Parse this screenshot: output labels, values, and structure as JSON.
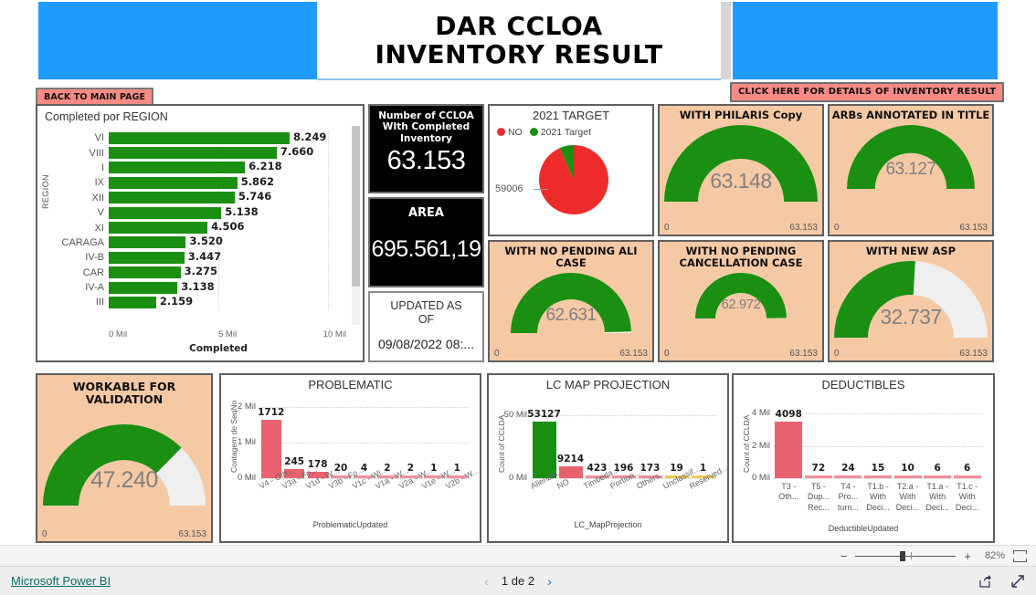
{
  "header": {
    "title_line1": "DAR CCLOA",
    "title_line2": "INVENTORY RESULT",
    "back_button": "BACK TO MAIN PAGE",
    "details_button": "CLICK HERE FOR DETAILS OF INVENTORY RESULT"
  },
  "colors": {
    "green": "#1a8f12",
    "red": "#ee2b2b",
    "pink_bar": "#e8636f",
    "pink_light": "#ef8f98",
    "yellow": "#f2c75c",
    "peach_tile": "#f6c9a5",
    "blue_banner": "#1f9bff",
    "button_pink": "#f98a84",
    "gauge_empty": "#efefef",
    "value_gray": "#808080"
  },
  "kpi": {
    "count_label": "Number of CCLOA With Completed Inventory",
    "count_label_lines": [
      "Number of CCLOA",
      "WIth Completed",
      "Inventory"
    ],
    "count_value": "63.153",
    "area_label": "AREA",
    "area_value": "695.561,19",
    "updated_label_lines": [
      "UPDATED AS",
      "OF"
    ],
    "updated_value": "09/08/2022 08:..."
  },
  "gauges": [
    {
      "id": "philaris",
      "title": "WITH PHILARIS Copy",
      "value": "63.148",
      "value_num": 63148,
      "min": "0",
      "max": "63.153",
      "max_num": 63153
    },
    {
      "id": "arbs",
      "title": "ARBs ANNOTATED IN TITLE",
      "value": "63.127",
      "value_num": 63127,
      "min": "0",
      "max": "63.153",
      "max_num": 63153
    },
    {
      "id": "ali",
      "title": "WITH NO PENDING ALI CASE",
      "value": "62.631",
      "value_num": 62631,
      "min": "0",
      "max": "63.153",
      "max_num": 63153
    },
    {
      "id": "cancel",
      "title": "WITH NO PENDING CANCELLATION CASE",
      "value": "62.972",
      "value_num": 62972,
      "min": "0",
      "max": "63.153",
      "max_num": 63153
    },
    {
      "id": "asp",
      "title": "WITH NEW ASP",
      "value": "32.737",
      "value_num": 32737,
      "min": "0",
      "max": "63.153",
      "max_num": 63153
    },
    {
      "id": "workable",
      "title": "WORKABLE FOR VALIDATION",
      "value": "47.240",
      "value_num": 47240,
      "min": "0",
      "max": "63.153",
      "max_num": 63153
    }
  ],
  "chart_data": [
    {
      "id": "region",
      "type": "bar",
      "title": "Completed por REGION",
      "xlabel": "Completed",
      "ylabel": "REGION",
      "categories": [
        "VI",
        "VIII",
        "I",
        "IX",
        "XII",
        "V",
        "XI",
        "CARAGA",
        "IV-B",
        "CAR",
        "IV-A",
        "III"
      ],
      "values": [
        8249,
        7660,
        6218,
        5862,
        5746,
        5138,
        4506,
        3520,
        3447,
        3275,
        3138,
        2159
      ],
      "value_labels": [
        "8.249",
        "7.660",
        "6.218",
        "5.862",
        "5.746",
        "5.138",
        "4.506",
        "3.520",
        "3.447",
        "3.275",
        "3.138",
        "2.159"
      ],
      "xticks": [
        "0 Mil",
        "5 Mil",
        "10 Mil"
      ],
      "xlim": [
        0,
        10000
      ],
      "orientation": "horizontal",
      "grid": true,
      "series_color": "#1a8f12"
    },
    {
      "id": "target2021",
      "type": "pie",
      "title": "2021 TARGET",
      "legend": [
        "NO",
        "2021 Target"
      ],
      "legend_position": "top-left",
      "labels": [
        "NO",
        "2021 Target"
      ],
      "values": [
        59006,
        4147
      ],
      "annotations": [
        "59006"
      ],
      "colors": [
        "#ee2b2b",
        "#1a8f12"
      ]
    },
    {
      "id": "problematic",
      "type": "bar",
      "title": "PROBLEMATIC",
      "xlabel": "ProblematicUpdated",
      "ylabel": "Contagem de SeqNo",
      "categories": [
        "V4 - Oth...",
        "V3a - Fo...",
        "V1d - W...",
        "V3b - Fo...",
        "V1c - Wi...",
        "V1a - W...",
        "V2a - W...",
        "V1e - W...",
        "V2b - W..."
      ],
      "values": [
        1712,
        245,
        178,
        20,
        4,
        2,
        2,
        1,
        1
      ],
      "value_labels": [
        "1712",
        "245",
        "178",
        "20",
        "4",
        "2",
        "2",
        "1",
        "1"
      ],
      "yticks": [
        "0 Mil",
        "1 Mil",
        "2 Mil"
      ],
      "ylim": [
        0,
        2000
      ],
      "grid": true,
      "series_color": "#e8636f"
    },
    {
      "id": "lcmap",
      "type": "bar",
      "title": "LC MAP PROJECTION",
      "xlabel": "LC_MapProjection",
      "ylabel": "Count of CCLDA",
      "categories": [
        "Alienabl...",
        "NO",
        "Timberla...",
        "Portion ...",
        "Others",
        "Unclassif...",
        "Reserved..."
      ],
      "values": [
        53127,
        9214,
        423,
        196,
        173,
        19,
        1
      ],
      "value_labels": [
        "53127",
        "9214",
        "423",
        "196",
        "173",
        "19",
        "1"
      ],
      "yticks": [
        "0 Mil",
        "50 Mil"
      ],
      "ylim": [
        0,
        55000
      ],
      "grid": true,
      "bar_colors": [
        "#1a8f12",
        "#e8636f",
        "#ef8f98",
        "#ef8f98",
        "#ef8f98",
        "#f2c75c",
        "#f2c75c"
      ]
    },
    {
      "id": "deductibles",
      "type": "bar",
      "title": "DEDUCTIBLES",
      "xlabel": "DeductibleUpdated",
      "ylabel": "Count of CCLDA",
      "categories": [
        "T3 - Oth...",
        "T5 - Dup... Rec...",
        "T4 - Pro... turn...",
        "T1.b - With Deci...",
        "T2.a - With Deci...",
        "T1.a - With Deci...",
        "T1.c - With Deci..."
      ],
      "category_lines": [
        [
          "T3 -",
          "Oth..."
        ],
        [
          "T5 -",
          "Dup...",
          "Rec..."
        ],
        [
          "T4 -",
          "Pro...",
          "turn..."
        ],
        [
          "T1.b -",
          "With",
          "Deci..."
        ],
        [
          "T2.a -",
          "With",
          "Deci..."
        ],
        [
          "T1.a -",
          "With",
          "Deci..."
        ],
        [
          "T1.c -",
          "With",
          "Deci..."
        ]
      ],
      "values": [
        4098,
        72,
        24,
        15,
        10,
        6,
        6
      ],
      "value_labels": [
        "4098",
        "72",
        "24",
        "15",
        "10",
        "6",
        "6"
      ],
      "yticks": [
        "0 Mil",
        "2 Mil",
        "4 Mil"
      ],
      "ylim": [
        0,
        4300
      ],
      "grid": true,
      "series_color": "#e8636f"
    }
  ],
  "footer": {
    "zoom_minus": "−",
    "zoom_plus": "+",
    "zoom_percent": "82%",
    "powerbi_link": "Microsoft Power BI",
    "page_label": "1 de 2",
    "prev_arrow": "‹",
    "next_arrow": "›"
  }
}
